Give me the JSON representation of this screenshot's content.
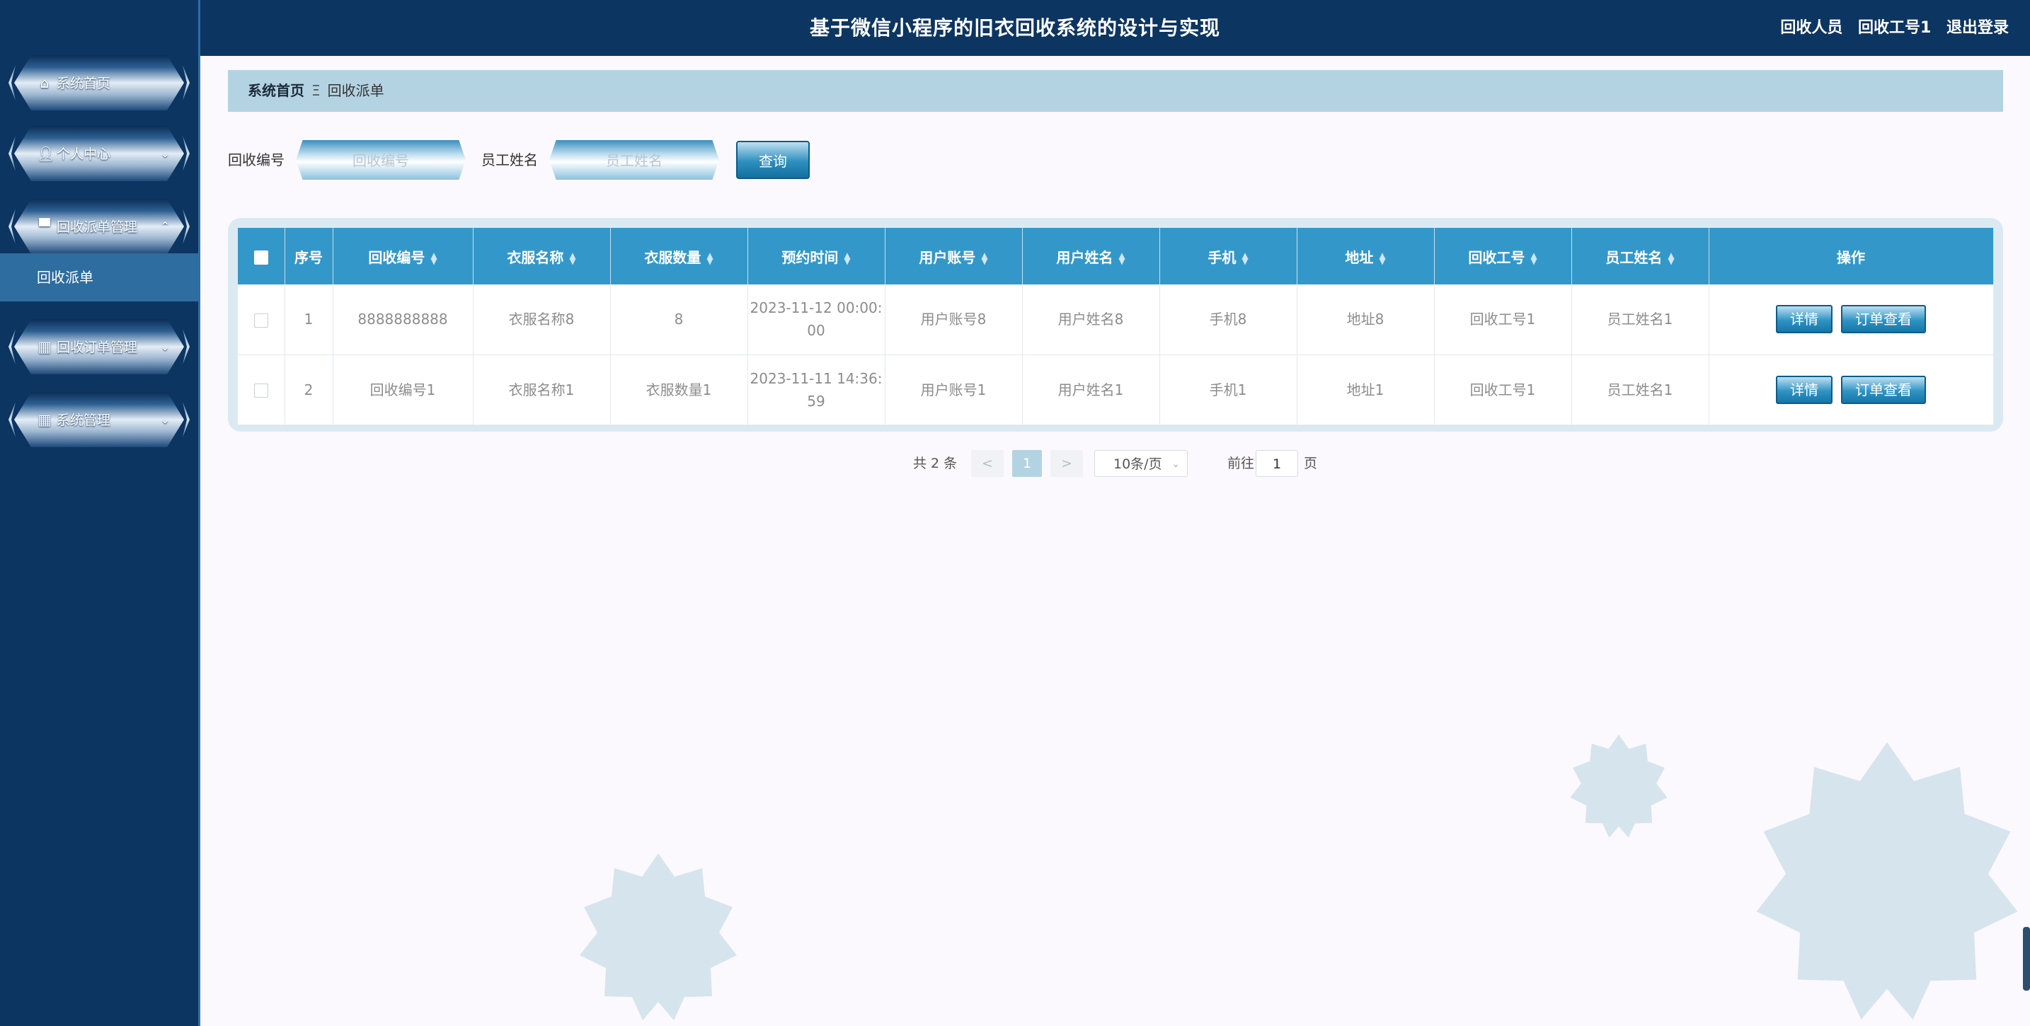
{
  "header": {
    "title": "基于微信小程序的旧衣回收系统的设计与实现",
    "role": "回收人员",
    "user": "回收工号1",
    "logout": "退出登录"
  },
  "sidebar": {
    "items": [
      {
        "label": "系统首页",
        "icon": "home-icon"
      },
      {
        "label": "个人中心",
        "icon": "user-icon"
      },
      {
        "label": "回收派单管理",
        "icon": "monitor-icon"
      },
      {
        "label": "回收订单管理",
        "icon": "grid-icon"
      },
      {
        "label": "系统管理",
        "icon": "grid-icon"
      }
    ],
    "submenu": "回收派单"
  },
  "breadcrumb": {
    "home": "系统首页",
    "separator": "Ξ",
    "current": "回收派单"
  },
  "search": {
    "field1_label": "回收编号",
    "field1_placeholder": "回收编号",
    "field2_label": "员工姓名",
    "field2_placeholder": "员工姓名",
    "button": "查询"
  },
  "table": {
    "columns": [
      "序号",
      "回收编号",
      "衣服名称",
      "衣服数量",
      "预约时间",
      "用户账号",
      "用户姓名",
      "手机",
      "地址",
      "回收工号",
      "员工姓名",
      "操作"
    ],
    "rows": [
      {
        "index": "1",
        "code": "8888888888",
        "name": "衣服名称8",
        "qty": "8",
        "time1": "2023-11-12 00:00:",
        "time2": "00",
        "account": "用户账号8",
        "username": "用户姓名8",
        "phone": "手机8",
        "address": "地址8",
        "worker_no": "回收工号1",
        "worker_name": "员工姓名1"
      },
      {
        "index": "2",
        "code": "回收编号1",
        "name": "衣服名称1",
        "qty": "衣服数量1",
        "time1": "2023-11-11 14:36:",
        "time2": "59",
        "account": "用户账号1",
        "username": "用户姓名1",
        "phone": "手机1",
        "address": "地址1",
        "worker_no": "回收工号1",
        "worker_name": "员工姓名1"
      }
    ],
    "actions": {
      "detail": "详情",
      "order": "订单查看"
    }
  },
  "pagination": {
    "total": "共 2 条",
    "prev": "<",
    "current": "1",
    "next": ">",
    "page_size": "10条/页",
    "goto_label": "前往",
    "goto_value": "1",
    "page_suffix": "页"
  },
  "colors": {
    "header_bg": "#0d3561",
    "accent": "#3398c9",
    "breadcrumb_bg": "#b4d3e2",
    "star": "#d6e4ed"
  }
}
